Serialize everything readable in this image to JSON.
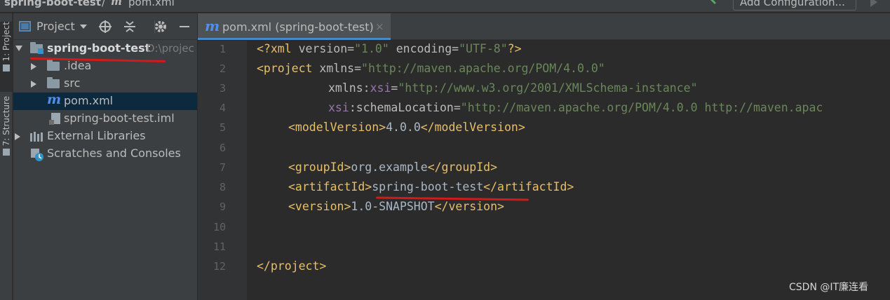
{
  "navbar": {
    "project": "spring-boot-test",
    "separator": "/",
    "file_icon": "m",
    "file": "pom.xml",
    "add_configuration": "Add Configuration...",
    "build_icon": "hammer-icon",
    "run_icon": "run-icon"
  },
  "tool_strip": {
    "project_tab": "1: Project",
    "structure_tab": "7: Structure"
  },
  "project_panel": {
    "title": "Project",
    "tree": [
      {
        "label": "spring-boot-test",
        "path": "D:\\projec",
        "expanded": true,
        "icon": "module-folder-icon"
      },
      {
        "label": ".idea",
        "expanded": false,
        "icon": "folder-icon"
      },
      {
        "label": "src",
        "expanded": false,
        "icon": "folder-icon"
      },
      {
        "label": "pom.xml",
        "icon": "maven-icon",
        "selected": true
      },
      {
        "label": "spring-boot-test.iml",
        "icon": "iml-file-icon"
      },
      {
        "label": "External Libraries",
        "expanded": false,
        "icon": "library-icon"
      },
      {
        "label": "Scratches and Consoles",
        "icon": "scratch-icon"
      }
    ]
  },
  "editor": {
    "tab_icon": "m",
    "tab_label": "pom.xml (spring-boot-test)",
    "tab_close": "×",
    "line_numbers": [
      "1",
      "2",
      "3",
      "4",
      "5",
      "6",
      "7",
      "8",
      "9",
      "10",
      "11",
      "12"
    ],
    "code": {
      "l1": {
        "pi_open": "<?xml ",
        "a1": "version",
        "eq1": "=",
        "v1": "\"1.0\"",
        "a2": " encoding",
        "eq2": "=",
        "v2": "\"UTF-8\"",
        "pi_close": "?>"
      },
      "l2": {
        "tag": "<project ",
        "a1": "xmlns",
        "eq": "=",
        "v1": "\"http://maven.apache.org/POM/4.0.0\""
      },
      "l3": {
        "ns": "xmlns:",
        "a": "xsi",
        "eq": "=",
        "v": "\"http://www.w3.org/2001/XMLSchema-instance\""
      },
      "l4": {
        "ns": "xsi",
        "a": ":schemaLocation",
        "eq": "=",
        "v": "\"http://maven.apache.org/POM/4.0.0 http://maven.apac"
      },
      "l5": {
        "open": "<modelVersion>",
        "text": "4.0.0",
        "close": "</modelVersion>"
      },
      "l7": {
        "open": "<groupId>",
        "text": "org.example",
        "close": "</groupId>"
      },
      "l8": {
        "open": "<artifactId>",
        "text": "spring-boot-test",
        "close": "</artifactId>"
      },
      "l9": {
        "open": "<version>",
        "text": "1.0-SNAPSHOT",
        "close": "</version>"
      },
      "l12": {
        "close": "</project>"
      }
    }
  },
  "watermark": "CSDN @IT廉连看",
  "colors": {
    "annotation_red": "#d11a1a",
    "tag": "#e8bf6a",
    "attr_value": "#6a8759",
    "namespace": "#9876aa",
    "selection": "#0d293e",
    "tab_underline": "#4a88c7"
  }
}
